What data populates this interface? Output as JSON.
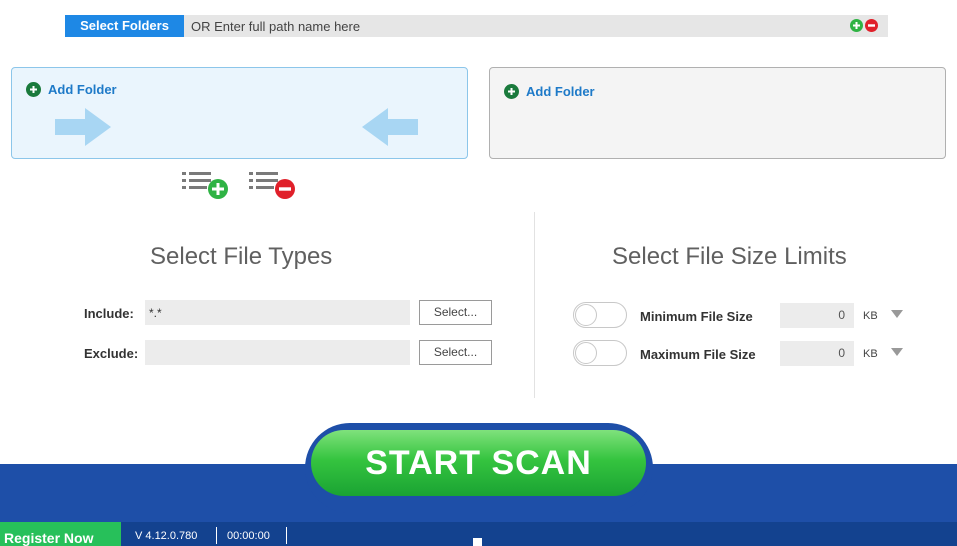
{
  "path_bar": {
    "select_label": "Select Folders",
    "placeholder": "OR Enter full path name here"
  },
  "folders": {
    "left_add_label": "Add Folder",
    "right_add_label": "Add Folder"
  },
  "file_types": {
    "title": "Select File Types",
    "include_label": "Include:",
    "include_value": "*.*",
    "exclude_label": "Exclude:",
    "exclude_value": "",
    "select_button": "Select..."
  },
  "size_limits": {
    "title": "Select File Size Limits",
    "min_label": "Minimum File Size",
    "min_value": "0",
    "max_label": "Maximum File Size",
    "max_value": "0",
    "unit": "KB",
    "min_enabled": false,
    "max_enabled": false
  },
  "start_label": "START SCAN",
  "status": {
    "register_label": "Register Now",
    "version": "V 4.12.0.780",
    "timer": "00:00:00"
  },
  "colors": {
    "accent_blue": "#1e88e5",
    "band_blue": "#1e4fa8",
    "start_green": "#35c43f",
    "register_green": "#27c05a",
    "add_red": "#e0202a"
  },
  "icons": [
    "plus-circle-icon",
    "minus-circle-icon",
    "arrow-right-icon",
    "arrow-left-icon",
    "list-add-icon",
    "list-remove-icon",
    "dropdown-arrow-icon"
  ]
}
